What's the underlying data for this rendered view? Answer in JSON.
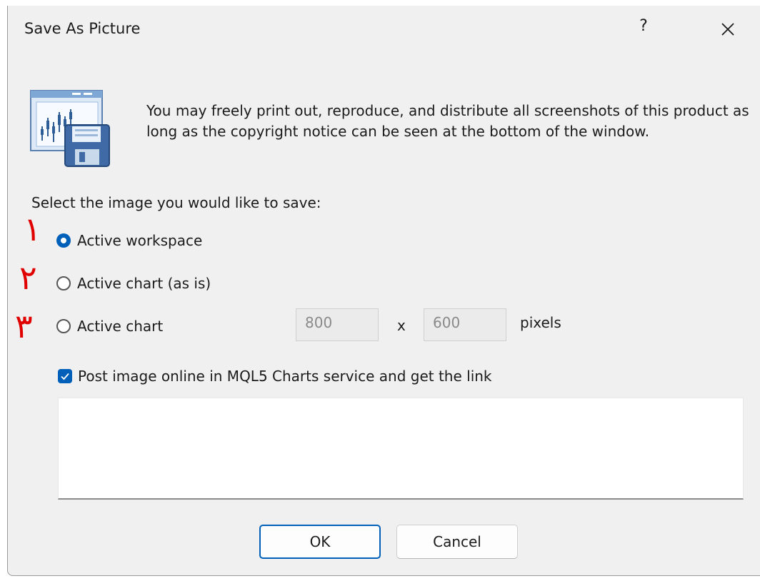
{
  "window": {
    "title": "Save As Picture",
    "help_label": "?",
    "close_icon": "close-icon"
  },
  "notice": {
    "icon": "chart-save-icon",
    "text": "You may freely print out, reproduce, and distribute all screenshots of this product as long as the copyright notice can be seen at the bottom of the window."
  },
  "select_label": "Select the image you would like to save:",
  "annotations": [
    "١",
    "٢",
    "٣"
  ],
  "options": [
    {
      "label": "Active workspace",
      "checked": true
    },
    {
      "label": "Active chart (as is)",
      "checked": false
    },
    {
      "label": "Active chart",
      "checked": false
    }
  ],
  "dimensions": {
    "width": "800",
    "separator": "x",
    "height": "600",
    "unit": "pixels"
  },
  "post_online": {
    "label": "Post image online in MQL5 Charts service and get the link",
    "checked": true
  },
  "link_box": {
    "value": ""
  },
  "buttons": {
    "ok": "OK",
    "cancel": "Cancel"
  },
  "colors": {
    "accent": "#005fb8",
    "annotation": "#e00000",
    "dialog_bg": "#f0f0f0"
  }
}
